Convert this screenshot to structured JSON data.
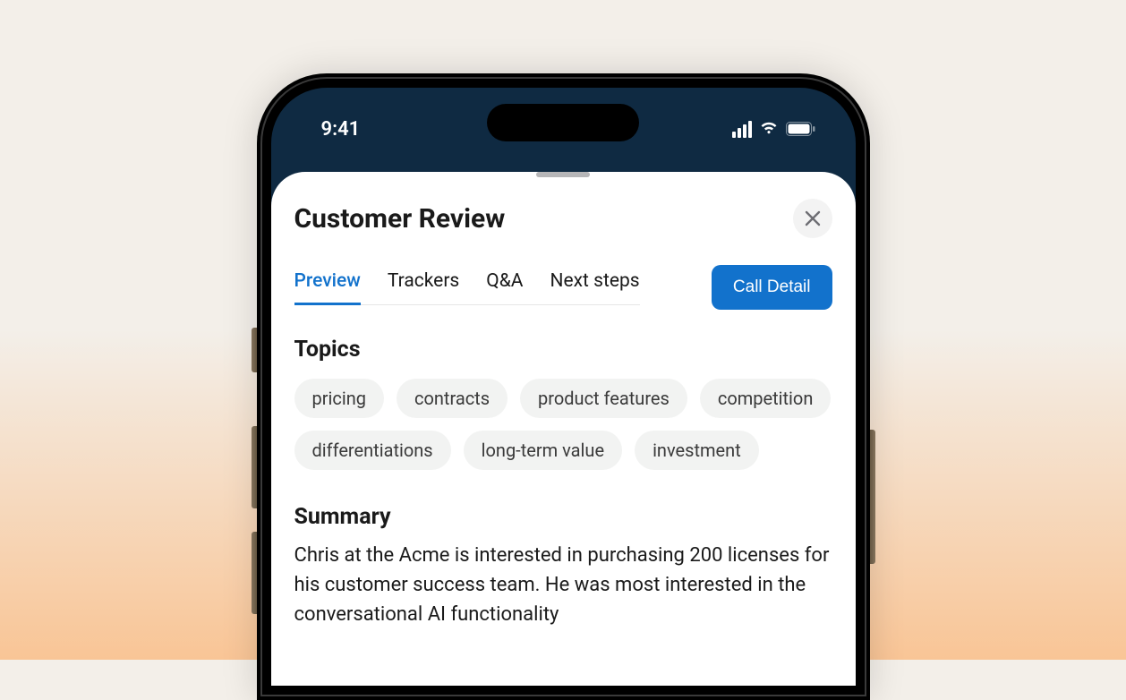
{
  "status_bar": {
    "time": "9:41"
  },
  "sheet": {
    "title": "Customer Review",
    "tabs": [
      {
        "label": "Preview",
        "active": true
      },
      {
        "label": "Trackers",
        "active": false
      },
      {
        "label": "Q&A",
        "active": false
      },
      {
        "label": "Next steps",
        "active": false
      }
    ],
    "primary_button_label": "Call Detail",
    "topics": {
      "heading": "Topics",
      "items": [
        "pricing",
        "contracts",
        "product features",
        "competition",
        "differentiations",
        "long-term value",
        "investment"
      ]
    },
    "summary": {
      "heading": "Summary",
      "text": "Chris at the Acme is interested in purchasing 200 licenses for his customer success team. He was most interested in the conversational AI functionality"
    }
  },
  "colors": {
    "accent": "#1272cc",
    "phone_header_bg": "#0f2a42",
    "chip_bg": "#f2f3f2"
  }
}
